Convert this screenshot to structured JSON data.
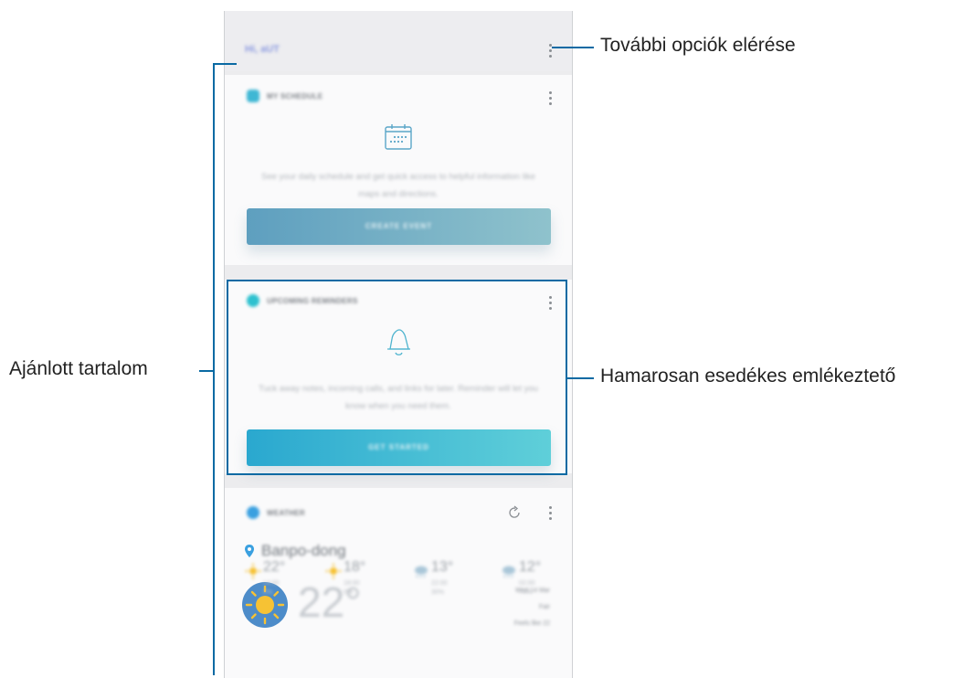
{
  "screen": {
    "header": {
      "title": "Hi, aUT"
    },
    "cards": {
      "schedule": {
        "title": "MY SCHEDULE",
        "description": "See your daily schedule and get quick access to helpful information like maps and directions.",
        "button": "CREATE EVENT"
      },
      "reminders": {
        "title": "UPCOMING REMINDERS",
        "description": "Tuck away notes, incoming calls, and links for later. Reminder will let you know when you need them.",
        "button": "GET STARTED"
      },
      "weather": {
        "title": "WEATHER",
        "location": "Banpo-dong",
        "temperature": "22°",
        "details": [
          "Wed 14 Mar",
          "Fair",
          "Feels like 22"
        ],
        "forecast": [
          {
            "temp": "22°",
            "time": "14:00",
            "rain": "0%",
            "icon": "sun-icon"
          },
          {
            "temp": "18°",
            "time": "18:00",
            "rain": "0%",
            "icon": "sun-icon"
          },
          {
            "temp": "13°",
            "time": "22:00",
            "rain": "30%",
            "icon": "cloud-rain-icon"
          },
          {
            "temp": "12°",
            "time": "02:00",
            "rain": "74%",
            "icon": "cloud-rain-icon"
          }
        ]
      }
    }
  },
  "annotations": {
    "more_options": "További opciók elérése",
    "suggested_content": "Ajánlott tartalom",
    "upcoming_reminder": "Hamarosan esedékes emlékeztető"
  },
  "colors": {
    "accent": "#0a6aa3",
    "schedule_button_from": "#5e9fbf",
    "schedule_button_to": "#8fc2cc",
    "reminder_button_from": "#2aa8cf",
    "reminder_button_to": "#5fcfd9",
    "sun": "#f6c234",
    "sun_bg": "#4d8cc9"
  }
}
